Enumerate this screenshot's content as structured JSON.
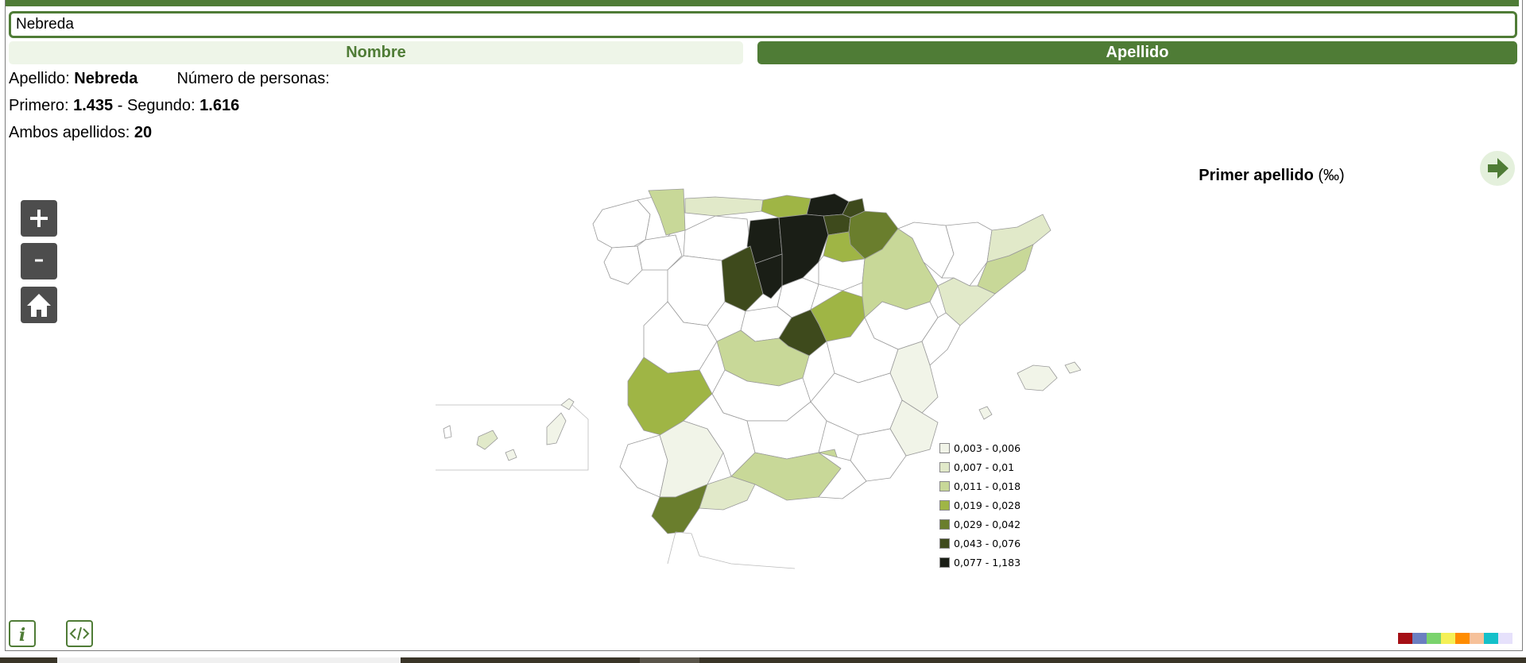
{
  "search": {
    "value": "Nebreda"
  },
  "tabs": {
    "nombre": "Nombre",
    "apellido": "Apellido"
  },
  "info": {
    "apellido_label": "Apellido: ",
    "apellido_value": "Nebreda",
    "personas_label": "Número de personas:",
    "primero_label": "Primero: ",
    "primero_value": "1.435",
    "segundo_label": " - Segundo: ",
    "segundo_value": "1.616",
    "ambos_label": "Ambos apellidos: ",
    "ambos_value": "20"
  },
  "map": {
    "title": "Primer apellido ",
    "unit": "(‰)",
    "legend": [
      {
        "label": "0,003 - 0,006",
        "color": "#f1f4e8"
      },
      {
        "label": "0,007 - 0,01",
        "color": "#e1e9c9"
      },
      {
        "label": "0,011 - 0,018",
        "color": "#c8d898"
      },
      {
        "label": "0,019 - 0,028",
        "color": "#9fb545"
      },
      {
        "label": "0,029 - 0,042",
        "color": "#6a7e2d"
      },
      {
        "label": "0,043 - 0,076",
        "color": "#3e4a1c"
      },
      {
        "label": "0,077 - 1,183",
        "color": "#1a1e16"
      }
    ]
  },
  "controls": {
    "zoom_in": "+",
    "zoom_out": "-"
  },
  "bottom": {
    "info": "i",
    "embed": "</>"
  },
  "palette": [
    "#a50f15",
    "#6b7fc1",
    "#7ad36d",
    "#f5f056",
    "#ff8c00",
    "#f6c19a",
    "#14c0c9",
    "#e6e1fb"
  ]
}
